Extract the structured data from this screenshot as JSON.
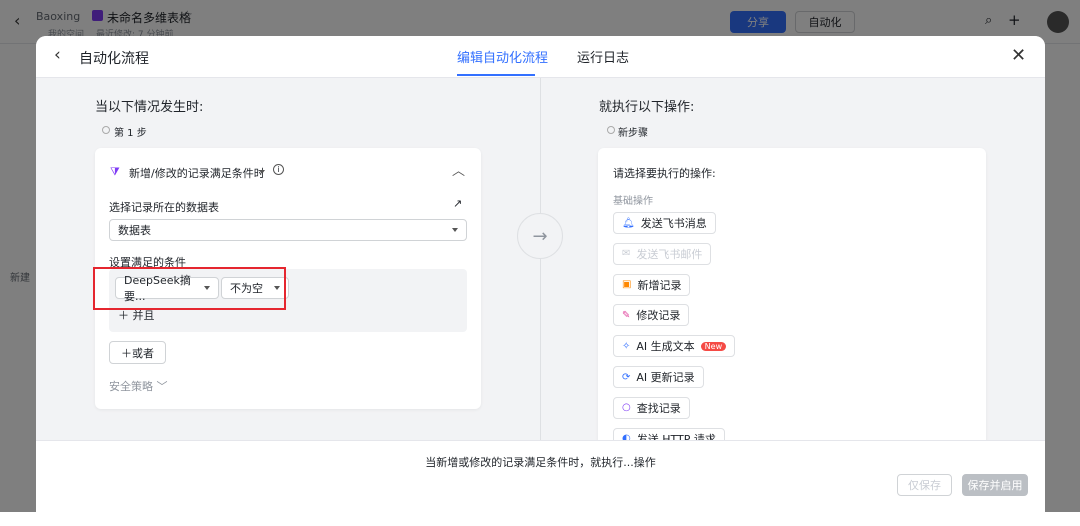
{
  "app": {
    "breadcrumb_root": "Baoxing",
    "doc_title": "未命名多维表格",
    "location": "我的空间",
    "last_modified": "最近修改: 7 分钟前",
    "share_label": "分享",
    "automation_label": "自动化",
    "sidebar_new": "新建"
  },
  "modal": {
    "title": "自动化流程",
    "tabs": [
      {
        "label": "编辑自动化流程",
        "active": true
      },
      {
        "label": "运行日志",
        "active": false
      }
    ]
  },
  "trigger": {
    "heading": "当以下情况发生时:",
    "step_label": "第 1 步",
    "type_label": "新增/修改的记录满足条件时",
    "table_label": "选择记录所在的数据表",
    "table_value": "数据表",
    "conditions_label": "设置满足的条件",
    "field_value": "DeepSeek摘要...",
    "operator_value": "不为空",
    "and_label": "并且",
    "or_label": "或者",
    "security_label": "安全策略"
  },
  "action": {
    "heading": "就执行以下操作:",
    "step_label": "新步骤",
    "prompt": "请选择要执行的操作:",
    "group_label": "基础操作",
    "items": [
      {
        "label": "发送飞书消息",
        "icon": "bell-icon",
        "color": "#3370ff",
        "disabled": false
      },
      {
        "label": "发送飞书邮件",
        "icon": "mail-icon",
        "color": "#c9cdd4",
        "disabled": true
      },
      {
        "label": "新增记录",
        "icon": "add-record-icon",
        "color": "#ff8800",
        "disabled": false
      },
      {
        "label": "修改记录",
        "icon": "edit-icon",
        "color": "#e0469e",
        "disabled": false
      },
      {
        "label": "AI 生成文本",
        "icon": "sparkle-icon",
        "color": "#3370ff",
        "disabled": false,
        "badge": "New"
      },
      {
        "label": "AI 更新记录",
        "icon": "refresh-icon",
        "color": "#3370ff",
        "disabled": false
      },
      {
        "label": "查找记录",
        "icon": "search-icon",
        "color": "#7f3bf5",
        "disabled": false
      },
      {
        "label": "发送 HTTP 请求",
        "icon": "http-icon",
        "color": "#3370ff",
        "disabled": false
      }
    ]
  },
  "footer": {
    "summary": "当新增或修改的记录满足条件时，就执行...操作",
    "save_only": "仅保存",
    "save_enable": "保存并启用"
  }
}
